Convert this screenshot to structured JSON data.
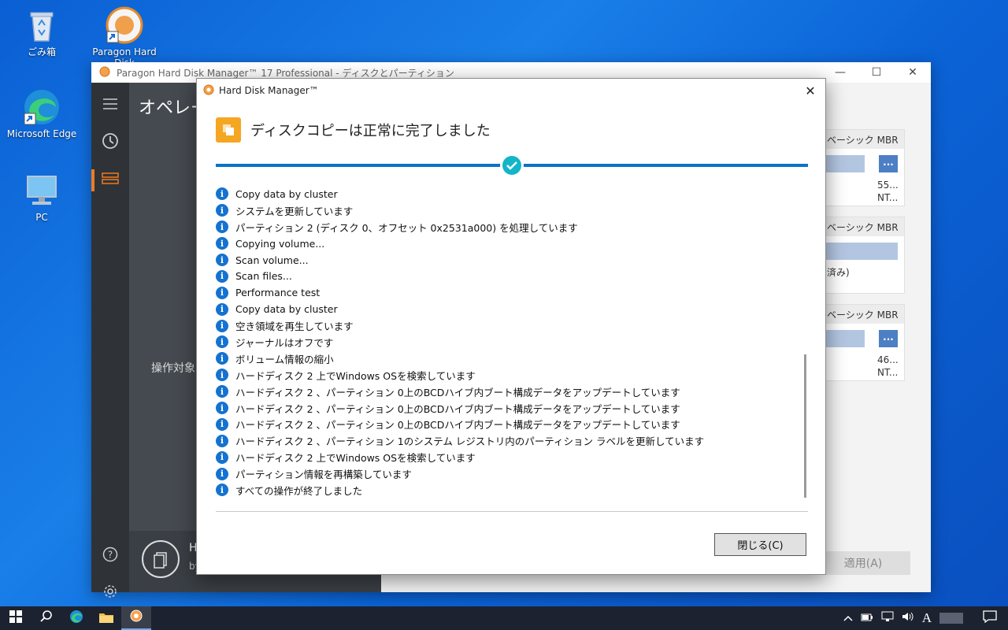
{
  "desktop": {
    "icons": [
      {
        "id": "recycle",
        "label": "ごみ箱"
      },
      {
        "id": "paragon",
        "label": "Paragon Hard Disk"
      },
      {
        "id": "edge",
        "label": "Microsoft Edge"
      },
      {
        "id": "pc",
        "label": "PC"
      }
    ]
  },
  "app": {
    "title": "Paragon Hard Disk Manager™ 17 Professional - ディスクとパーティション",
    "panel_title": "オペレー",
    "panel_sub": "操作対象",
    "panel_bottom_h": "H",
    "panel_bottom_by": "by",
    "disk_cards": [
      {
        "header": "B ベーシック MBR",
        "info1": "55...",
        "info2": "NT..."
      },
      {
        "header": "B ベーシック MBR",
        "info1": "用済み)",
        "info2": ""
      },
      {
        "header": "B ベーシック MBR",
        "info1": "46...",
        "info2": "NT..."
      }
    ],
    "apply_label": "適用(A)"
  },
  "dialog": {
    "title": "Hard Disk Manager™",
    "heading": "ディスクコピーは正常に完了しました",
    "log": [
      "Copy data by cluster",
      "システムを更新しています",
      "パーティション 2 (ディスク 0、オフセット 0x2531a000) を処理しています",
      "Copying volume...",
      "Scan volume...",
      "Scan files...",
      "Performance test",
      "Copy data by cluster",
      "空き領域を再生しています",
      "ジャーナルはオフです",
      "ボリューム情報の縮小",
      "ハードディスク 2 上でWindows OSを検索しています",
      "ハードディスク 2 、パーティション 0上のBCDハイブ内ブート構成データをアップデートしています",
      "ハードディスク 2 、パーティション 0上のBCDハイブ内ブート構成データをアップデートしています",
      "ハードディスク 2 、パーティション 0上のBCDハイブ内ブート構成データをアップデートしています",
      "ハードディスク 2 、パーティション 1のシステム レジストリ内のパーティション ラベルを更新しています",
      "ハードディスク 2 上でWindows OSを検索しています",
      "パーティション情報を再構築しています",
      "すべての操作が終了しました"
    ],
    "close_label": "閉じる(C)"
  },
  "taskbar": {
    "ime_label": "A"
  },
  "colors": {
    "accent": "#0a72c9",
    "check": "#14b5c8",
    "heading_badge": "#f5a623",
    "sidebar": "#2f3338",
    "sidebar_active": "#f07a1e"
  }
}
